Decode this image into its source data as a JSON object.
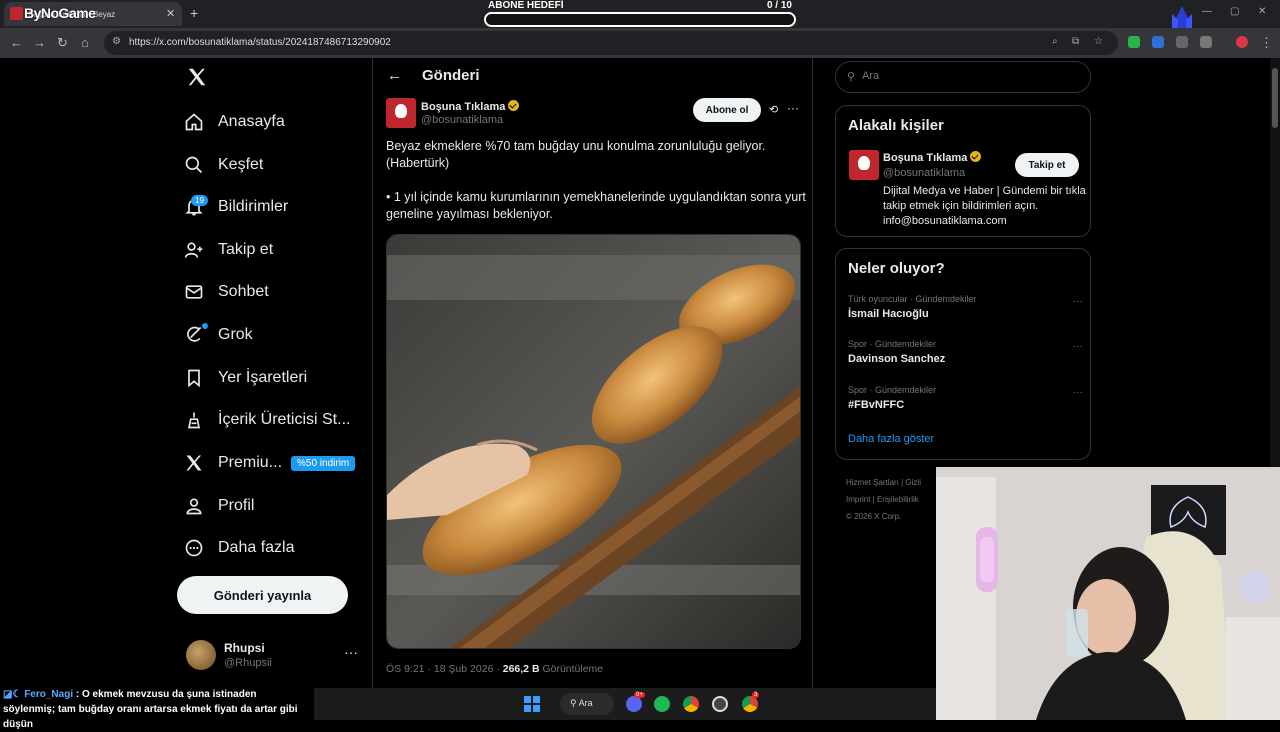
{
  "browser": {
    "tab_title": "Boşuna Tıklama: \"Beyaz",
    "watermark": "ByNoGame",
    "new_tab": "+",
    "url": "https://x.com/bosunatiklama/status/2024187486713290902"
  },
  "overlay_goal": {
    "title": "ABONE HEDEFİ",
    "count": "0  / 10",
    "progress": 0
  },
  "nav": {
    "items": [
      {
        "label": "Anasayfa",
        "icon": "home-icon"
      },
      {
        "label": "Keşfet",
        "icon": "search-icon"
      },
      {
        "label": "Bildirimler",
        "icon": "bell-icon"
      },
      {
        "label": "Takip et",
        "icon": "follow-icon"
      },
      {
        "label": "Sohbet",
        "icon": "mail-icon"
      },
      {
        "label": "Grok",
        "icon": "grok-icon"
      },
      {
        "label": "Yer İşaretleri",
        "icon": "bookmark-icon"
      },
      {
        "label": "İçerik Üreticisi St...",
        "icon": "creator-icon"
      },
      {
        "label": "Premiu...",
        "icon": "x-icon"
      },
      {
        "label": "Profil",
        "icon": "profile-icon"
      },
      {
        "label": "Daha fazla",
        "icon": "more-icon"
      }
    ],
    "notif_badge": "19",
    "premium_badge": "%50 indirim",
    "post_button": "Gönderi yayınla",
    "profile": {
      "name": "Rhupsi",
      "handle": "@Rhupsii",
      "more": "···"
    }
  },
  "post": {
    "header": "Gönderi",
    "author_name": "Boşuna Tıklama",
    "author_handle": "@bosunatiklama",
    "subscribe": "Abone ol",
    "text": "Beyaz ekmeklere %70 tam buğday unu konulma zorunluluğu geliyor. (Habertürk)\n\n• 1 yıl içinde kamu kurumlarının yemekhanelerinde uygulandıktan sonra yurt geneline yayılması bekleniyor.",
    "time": "ÖS 9:21 · 18 Şub 2026 · ",
    "views": "266,2 B",
    "views_label": " Görüntüleme"
  },
  "right": {
    "search_placeholder": "Ara",
    "related_title": "Alakalı kişiler",
    "related": {
      "name": "Boşuna Tıklama",
      "handle": "@bosunatiklama",
      "follow": "Takip et",
      "bio": "Dijital Medya ve Haber | Gündemi bir tıkla takip etmek için bildirimleri açın. info@bosunatiklama.com"
    },
    "trends_title": "Neler oluyor?",
    "trends": [
      {
        "category": "Türk oyuncular · Gündemdekiler",
        "name": "İsmail Hacıoğlu"
      },
      {
        "category": "Spor · Gündemdekiler",
        "name": "Davinson Sanchez"
      },
      {
        "category": "Spor · Gündemdekiler",
        "name": "#FBvNFFC"
      }
    ],
    "show_more": "Daha fazla göster",
    "footer": [
      "Hizmet Şartları  |  Gizli",
      "Imprint  |  Erişilebilirlik",
      "© 2026 X Corp."
    ]
  },
  "chat": {
    "user": "Fero_Nagi",
    "message": " : O ekmek mevzusu da şuna istinaden söylenmiş; tam buğday oranı artarsa ekmek fiyatı da artar gibi düşün"
  },
  "taskbar": {
    "search": "Ara",
    "badge1": "9+",
    "badge2": "3"
  },
  "colors": {
    "accent": "#1d9bf0",
    "brand_red": "#c0262d",
    "verified": "#e2b719"
  }
}
